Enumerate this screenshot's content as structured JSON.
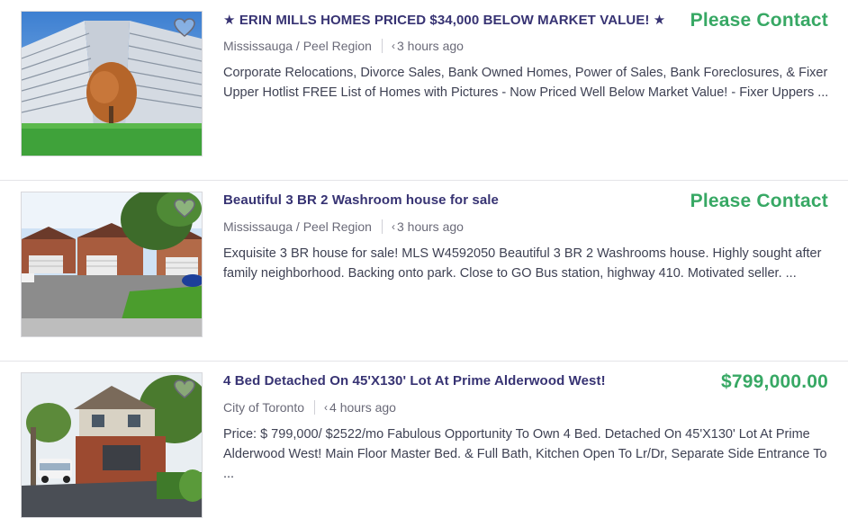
{
  "listings": [
    {
      "title": "★ ERIN MILLS HOMES PRICED $34,000 BELOW MARKET VALUE! ★",
      "price": "Please Contact",
      "price_color": "#37a864",
      "location": "Mississauga / Peel Region",
      "posted": "3 hours ago",
      "description": "Corporate Relocations, Divorce Sales, Bank Owned Homes, Power of Sales, Bank Foreclosures, & Fixer Upper Hotlist FREE List of Homes with Pictures - Now Priced Well Below Market Value! - Fixer Uppers ...",
      "image": "apartment-tower-photo",
      "favorite_icon": "heart-outline-icon"
    },
    {
      "title": "Beautiful 3 BR 2 Washroom house for sale",
      "price": "Please Contact",
      "price_color": "#37a864",
      "location": "Mississauga / Peel Region",
      "posted": "3 hours ago",
      "description": "Exquisite 3 BR house for sale! MLS W4592050 Beautiful 3 BR 2 Washrooms house. Highly sought after family neighborhood. Backing onto park. Close to GO Bus station, highway 410. Motivated seller. ...",
      "image": "townhouse-row-photo",
      "favorite_icon": "heart-outline-icon"
    },
    {
      "title": "4 Bed Detached On 45'X130' Lot At Prime Alderwood West!",
      "price": "$799,000.00",
      "price_color": "#37a864",
      "location": "City of Toronto",
      "posted": "4 hours ago",
      "description": "Price: $ 799,000/ $2522/mo Fabulous Opportunity To Own 4 Bed. Detached On 45'X130' Lot At Prime Alderwood West! Main Floor Master Bed. & Full Bath, Kitchen Open To Lr/Dr, Separate Side Entrance To ...",
      "image": "detached-house-photo",
      "favorite_icon": "heart-outline-icon"
    }
  ],
  "colors": {
    "title": "#373373",
    "price": "#37a864",
    "meta": "#6a6a78",
    "description": "#3e4153",
    "divider": "#e4e4e8"
  }
}
